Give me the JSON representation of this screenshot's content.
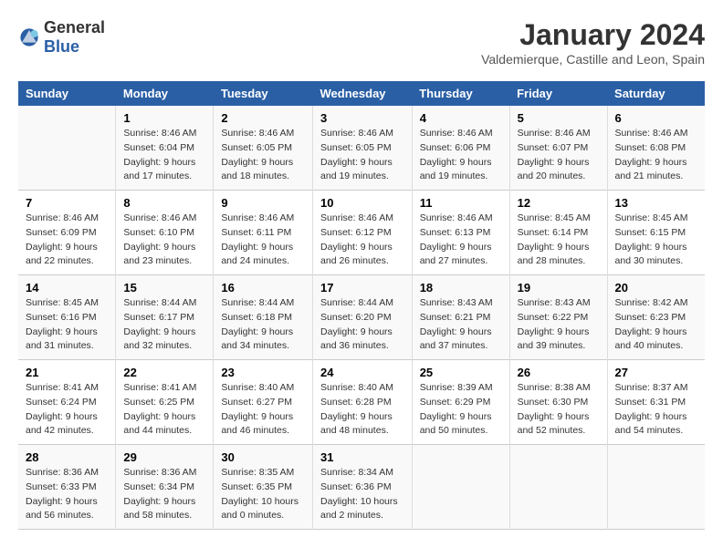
{
  "header": {
    "logo_general": "General",
    "logo_blue": "Blue",
    "main_title": "January 2024",
    "subtitle": "Valdemierque, Castille and Leon, Spain"
  },
  "calendar": {
    "days_of_week": [
      "Sunday",
      "Monday",
      "Tuesday",
      "Wednesday",
      "Thursday",
      "Friday",
      "Saturday"
    ],
    "weeks": [
      [
        {
          "day": "",
          "info": ""
        },
        {
          "day": "1",
          "info": "Sunrise: 8:46 AM\nSunset: 6:04 PM\nDaylight: 9 hours\nand 17 minutes."
        },
        {
          "day": "2",
          "info": "Sunrise: 8:46 AM\nSunset: 6:05 PM\nDaylight: 9 hours\nand 18 minutes."
        },
        {
          "day": "3",
          "info": "Sunrise: 8:46 AM\nSunset: 6:05 PM\nDaylight: 9 hours\nand 19 minutes."
        },
        {
          "day": "4",
          "info": "Sunrise: 8:46 AM\nSunset: 6:06 PM\nDaylight: 9 hours\nand 19 minutes."
        },
        {
          "day": "5",
          "info": "Sunrise: 8:46 AM\nSunset: 6:07 PM\nDaylight: 9 hours\nand 20 minutes."
        },
        {
          "day": "6",
          "info": "Sunrise: 8:46 AM\nSunset: 6:08 PM\nDaylight: 9 hours\nand 21 minutes."
        }
      ],
      [
        {
          "day": "7",
          "info": ""
        },
        {
          "day": "8",
          "info": "Sunrise: 8:46 AM\nSunset: 6:10 PM\nDaylight: 9 hours\nand 23 minutes."
        },
        {
          "day": "9",
          "info": "Sunrise: 8:46 AM\nSunset: 6:11 PM\nDaylight: 9 hours\nand 24 minutes."
        },
        {
          "day": "10",
          "info": "Sunrise: 8:46 AM\nSunset: 6:12 PM\nDaylight: 9 hours\nand 26 minutes."
        },
        {
          "day": "11",
          "info": "Sunrise: 8:46 AM\nSunset: 6:13 PM\nDaylight: 9 hours\nand 27 minutes."
        },
        {
          "day": "12",
          "info": "Sunrise: 8:45 AM\nSunset: 6:14 PM\nDaylight: 9 hours\nand 28 minutes."
        },
        {
          "day": "13",
          "info": "Sunrise: 8:45 AM\nSunset: 6:15 PM\nDaylight: 9 hours\nand 30 minutes."
        }
      ],
      [
        {
          "day": "14",
          "info": ""
        },
        {
          "day": "15",
          "info": "Sunrise: 8:44 AM\nSunset: 6:17 PM\nDaylight: 9 hours\nand 32 minutes."
        },
        {
          "day": "16",
          "info": "Sunrise: 8:44 AM\nSunset: 6:18 PM\nDaylight: 9 hours\nand 34 minutes."
        },
        {
          "day": "17",
          "info": "Sunrise: 8:44 AM\nSunset: 6:20 PM\nDaylight: 9 hours\nand 36 minutes."
        },
        {
          "day": "18",
          "info": "Sunrise: 8:43 AM\nSunset: 6:21 PM\nDaylight: 9 hours\nand 37 minutes."
        },
        {
          "day": "19",
          "info": "Sunrise: 8:43 AM\nSunset: 6:22 PM\nDaylight: 9 hours\nand 39 minutes."
        },
        {
          "day": "20",
          "info": "Sunrise: 8:42 AM\nSunset: 6:23 PM\nDaylight: 9 hours\nand 40 minutes."
        }
      ],
      [
        {
          "day": "21",
          "info": ""
        },
        {
          "day": "22",
          "info": "Sunrise: 8:41 AM\nSunset: 6:25 PM\nDaylight: 9 hours\nand 44 minutes."
        },
        {
          "day": "23",
          "info": "Sunrise: 8:40 AM\nSunset: 6:27 PM\nDaylight: 9 hours\nand 46 minutes."
        },
        {
          "day": "24",
          "info": "Sunrise: 8:40 AM\nSunset: 6:28 PM\nDaylight: 9 hours\nand 48 minutes."
        },
        {
          "day": "25",
          "info": "Sunrise: 8:39 AM\nSunset: 6:29 PM\nDaylight: 9 hours\nand 50 minutes."
        },
        {
          "day": "26",
          "info": "Sunrise: 8:38 AM\nSunset: 6:30 PM\nDaylight: 9 hours\nand 52 minutes."
        },
        {
          "day": "27",
          "info": "Sunrise: 8:37 AM\nSunset: 6:31 PM\nDaylight: 9 hours\nand 54 minutes."
        }
      ],
      [
        {
          "day": "28",
          "info": ""
        },
        {
          "day": "29",
          "info": "Sunrise: 8:36 AM\nSunset: 6:34 PM\nDaylight: 9 hours\nand 58 minutes."
        },
        {
          "day": "30",
          "info": "Sunrise: 8:35 AM\nSunset: 6:35 PM\nDaylight: 10 hours\nand 0 minutes."
        },
        {
          "day": "31",
          "info": "Sunrise: 8:34 AM\nSunset: 6:36 PM\nDaylight: 10 hours\nand 2 minutes."
        },
        {
          "day": "",
          "info": ""
        },
        {
          "day": "",
          "info": ""
        },
        {
          "day": "",
          "info": ""
        }
      ]
    ],
    "week_sunday_info": {
      "7": "Sunrise: 8:46 AM\nSunset: 6:09 PM\nDaylight: 9 hours\nand 22 minutes.",
      "14": "Sunrise: 8:45 AM\nSunset: 6:16 PM\nDaylight: 9 hours\nand 31 minutes.",
      "21": "Sunrise: 8:41 AM\nSunset: 6:24 PM\nDaylight: 9 hours\nand 42 minutes.",
      "28": "Sunrise: 8:36 AM\nSunset: 6:33 PM\nDaylight: 9 hours\nand 56 minutes."
    }
  }
}
